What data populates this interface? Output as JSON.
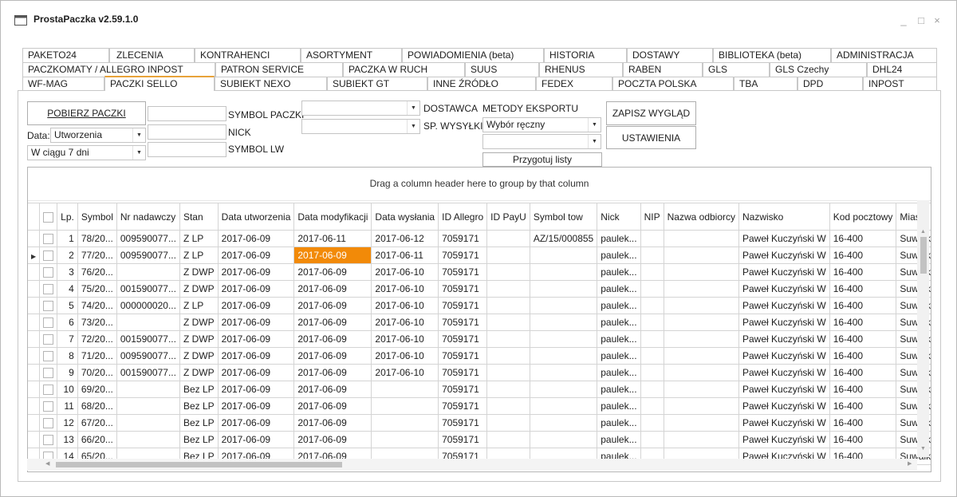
{
  "window": {
    "title": "ProstaPaczka v2.59.1.0",
    "min": "_",
    "max": "□",
    "close": "×"
  },
  "tabs": {
    "row1": [
      "PAKETO24",
      "ZLECENIA",
      "KONTRAHENCI",
      "ASORTYMENT",
      "POWIADOMIENIA (beta)",
      "HISTORIA",
      "DOSTAWY",
      "BIBLIOTEKA (beta)",
      "ADMINISTRACJA"
    ],
    "row2": [
      "PACZKOMATY / ALLEGRO INPOST",
      "PATRON SERVICE",
      "PACZKA W RUCH",
      "SUUS",
      "RHENUS",
      "RABEN",
      "GLS",
      "GLS Czechy",
      "DHL24"
    ],
    "row3": [
      "WF-MAG",
      "PACZKI SELLO",
      "SUBIEKT NEXO",
      "SUBIEKT GT",
      "INNE ŹRÓDŁO",
      "FEDEX",
      "POCZTA POLSKA",
      "TBA",
      "DPD",
      "INPOST"
    ],
    "active": "PACZKI SELLO"
  },
  "toolbar": {
    "fetch_button": "POBIERZ PACZKI",
    "data_label": "Data:",
    "date_type": "Utworzenia",
    "period": "W ciągu 7 dni",
    "symbol_paczki": "SYMBOL PACZKI",
    "nick": "NICK",
    "symbol_lw": "SYMBOL LW",
    "dostawca": "DOSTAWCA",
    "sp_wysylki": "SP. WYSYŁKI",
    "metody_eksportu": "METODY EKSPORTU",
    "metoda_value": "Wybór ręczny",
    "przygotuj": "Przygotuj listy",
    "zapisz_button": "ZAPISZ WYGLĄD",
    "ustawienia_button": "USTAWIENIA"
  },
  "grid": {
    "group_hint": "Drag a column header here to group by that column",
    "columns": [
      "Lp.",
      "Symbol",
      "Nr nadawczy",
      "Stan",
      "Data utworzenia",
      "Data modyfikacji",
      "Data wysłania",
      "ID Allegro",
      "ID PayU",
      "Symbol tow",
      "Nick",
      "NIP",
      "Nazwa odbiorcy",
      "Nazwisko",
      "Kod pocztowy",
      "Miasto"
    ],
    "rows": [
      [
        "1",
        "78/20...",
        "009590077...",
        "Z LP",
        "2017-06-09",
        "2017-06-11",
        "2017-06-12",
        "7059171",
        "",
        "AZ/15/000855",
        "paulek...",
        "",
        "",
        "Paweł Kuczyński W",
        "16-400",
        "Suwałk"
      ],
      [
        "2",
        "77/20...",
        "009590077...",
        "Z LP",
        "2017-06-09",
        "2017-06-09",
        "2017-06-11",
        "7059171",
        "",
        "",
        "paulek...",
        "",
        "",
        "Paweł Kuczyński W",
        "16-400",
        "Suwałk"
      ],
      [
        "3",
        "76/20...",
        "",
        "Z DWP",
        "2017-06-09",
        "2017-06-09",
        "2017-06-10",
        "7059171",
        "",
        "",
        "paulek...",
        "",
        "",
        "Paweł Kuczyński W",
        "16-400",
        "Suwałk"
      ],
      [
        "4",
        "75/20...",
        "001590077...",
        "Z DWP",
        "2017-06-09",
        "2017-06-09",
        "2017-06-10",
        "7059171",
        "",
        "",
        "paulek...",
        "",
        "",
        "Paweł Kuczyński W",
        "16-400",
        "Suwałk"
      ],
      [
        "5",
        "74/20...",
        "000000020...",
        "Z LP",
        "2017-06-09",
        "2017-06-09",
        "2017-06-10",
        "7059171",
        "",
        "",
        "paulek...",
        "",
        "",
        "Paweł Kuczyński W",
        "16-400",
        "Suwałk"
      ],
      [
        "6",
        "73/20...",
        "",
        "Z DWP",
        "2017-06-09",
        "2017-06-09",
        "2017-06-10",
        "7059171",
        "",
        "",
        "paulek...",
        "",
        "",
        "Paweł Kuczyński W",
        "16-400",
        "Suwałk"
      ],
      [
        "7",
        "72/20...",
        "001590077...",
        "Z DWP",
        "2017-06-09",
        "2017-06-09",
        "2017-06-10",
        "7059171",
        "",
        "",
        "paulek...",
        "",
        "",
        "Paweł Kuczyński W",
        "16-400",
        "Suwałk"
      ],
      [
        "8",
        "71/20...",
        "009590077...",
        "Z DWP",
        "2017-06-09",
        "2017-06-09",
        "2017-06-10",
        "7059171",
        "",
        "",
        "paulek...",
        "",
        "",
        "Paweł Kuczyński W",
        "16-400",
        "Suwałk"
      ],
      [
        "9",
        "70/20...",
        "001590077...",
        "Z DWP",
        "2017-06-09",
        "2017-06-09",
        "2017-06-10",
        "7059171",
        "",
        "",
        "paulek...",
        "",
        "",
        "Paweł Kuczyński W",
        "16-400",
        "Suwałk"
      ],
      [
        "10",
        "69/20...",
        "",
        "Bez LP",
        "2017-06-09",
        "2017-06-09",
        "",
        "7059171",
        "",
        "",
        "paulek...",
        "",
        "",
        "Paweł Kuczyński W",
        "16-400",
        "Suwałk"
      ],
      [
        "11",
        "68/20...",
        "",
        "Bez LP",
        "2017-06-09",
        "2017-06-09",
        "",
        "7059171",
        "",
        "",
        "paulek...",
        "",
        "",
        "Paweł Kuczyński W",
        "16-400",
        "Suwałk"
      ],
      [
        "12",
        "67/20...",
        "",
        "Bez LP",
        "2017-06-09",
        "2017-06-09",
        "",
        "7059171",
        "",
        "",
        "paulek...",
        "",
        "",
        "Paweł Kuczyński W",
        "16-400",
        "Suwałk"
      ],
      [
        "13",
        "66/20...",
        "",
        "Bez LP",
        "2017-06-09",
        "2017-06-09",
        "",
        "7059171",
        "",
        "",
        "paulek...",
        "",
        "",
        "Paweł Kuczyński W",
        "16-400",
        "Suwałk"
      ],
      [
        "14",
        "65/20...",
        "",
        "Bez LP",
        "2017-06-09",
        "2017-06-09",
        "",
        "7059171",
        "",
        "",
        "paulek...",
        "",
        "",
        "Paweł Kuczyński W",
        "16-400",
        "Suwałk"
      ]
    ],
    "current_row": 2,
    "selected_cell_column": "Data modyfikacji",
    "selected_cell_color": "#f28a08"
  },
  "colors": {
    "active_tab_accent": "#e8a33a"
  }
}
